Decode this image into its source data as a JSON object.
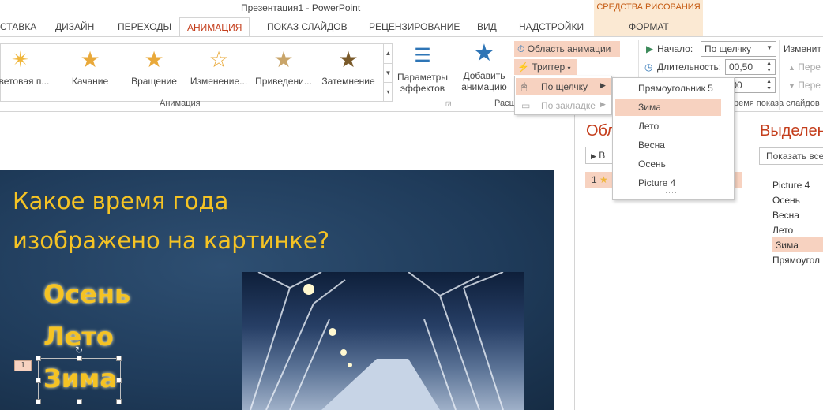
{
  "window": {
    "title": "Презентация1 - PowerPoint"
  },
  "context_tab_group": {
    "header": "СРЕДСТВА РИСОВАНИЯ",
    "tab": "ФОРМАТ"
  },
  "tabs": [
    {
      "label": "СТАВКА"
    },
    {
      "label": "ДИЗАЙН"
    },
    {
      "label": "ПЕРЕХОДЫ"
    },
    {
      "label": "АНИМАЦИЯ",
      "active": true
    },
    {
      "label": "ПОКАЗ СЛАЙДОВ"
    },
    {
      "label": "РЕЦЕНЗИРОВАНИЕ"
    },
    {
      "label": "ВИД"
    },
    {
      "label": "НАДСТРОЙКИ"
    }
  ],
  "animation_gallery": {
    "items": [
      {
        "label": "Цветовая п...",
        "icon": "star-color-pulse-icon"
      },
      {
        "label": "Качание",
        "icon": "star-teeter-icon"
      },
      {
        "label": "Вращение",
        "icon": "star-spin-icon"
      },
      {
        "label": "Изменение...",
        "icon": "star-grow-shrink-icon"
      },
      {
        "label": "Приведени...",
        "icon": "star-desaturate-icon"
      },
      {
        "label": "Затемнение",
        "icon": "star-darken-icon"
      }
    ],
    "group_label": "Анимация"
  },
  "effect_options": {
    "line1": "Параметры",
    "line2": "эффектов"
  },
  "add_animation": {
    "line1": "Добавить",
    "line2": "анимацию"
  },
  "advanced_group_label_fragment": "Расш",
  "animation_pane_button": "Область анимации",
  "trigger_button": "Триггер",
  "timing": {
    "start_label": "Начало:",
    "start_value": "По щелчку",
    "duration_label": "Длительность:",
    "duration_value": "00,50",
    "delay_value": ",00",
    "group_label_fragment": "ремя показа слайдов",
    "reorder_label": "Изменит",
    "move_earlier": "Пере",
    "move_later": "Пере"
  },
  "trigger_menu": {
    "on_click": "По щелчку",
    "on_bookmark": "По закладке"
  },
  "trigger_submenu": {
    "items": [
      "Прямоугольник 5",
      "Зима",
      "Лето",
      "Весна",
      "Осень",
      "Picture 4"
    ],
    "highlighted": "Зима"
  },
  "animation_pane": {
    "title_fragment": "Обл",
    "play_fragment": "В",
    "item_number": "1"
  },
  "selection_pane": {
    "title_fragment": "Выделен",
    "show_all_fragment": "Показать все",
    "items": [
      "Picture 4",
      "Осень",
      "Весна",
      "Лето",
      "Зима",
      "Прямоугол"
    ],
    "highlighted": "Зима"
  },
  "slide": {
    "title_line1": "Какое время года",
    "title_line2": "изображено на картинке?",
    "options": [
      "Осень",
      "Лето",
      "Зима"
    ],
    "anim_tag": "1"
  },
  "colors": {
    "accent": "#c43e1c",
    "highlight": "#f7d2c0",
    "slide_text": "#f5c324",
    "slide_bg": "#1f3b5a",
    "context_tab_bg": "#fbe9d3"
  }
}
